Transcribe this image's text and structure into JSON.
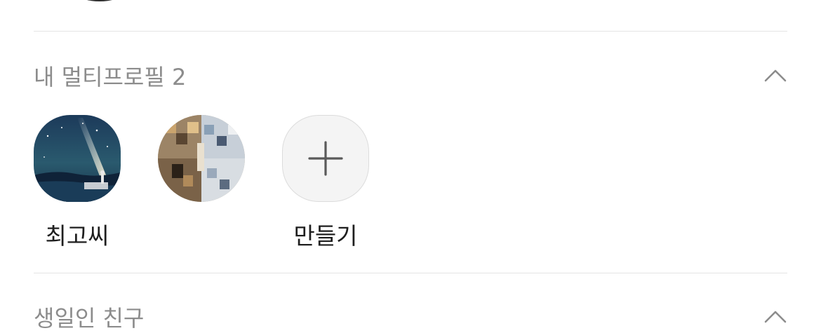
{
  "multi_profile_section": {
    "title": "내 멀티프로필 2",
    "expanded": true,
    "profiles": [
      {
        "name": "최고씨",
        "icon": "night-sky-avatar"
      },
      {
        "name": "",
        "icon": "pixelated-photo-avatar"
      },
      {
        "name": "만들기",
        "icon": "plus-icon"
      }
    ]
  },
  "birthday_section": {
    "title": "생일인 친구",
    "expanded": true
  },
  "colors": {
    "header_text": "#8c8c8c",
    "name_text": "#1e1e1e",
    "divider": "#e4e4e4"
  }
}
